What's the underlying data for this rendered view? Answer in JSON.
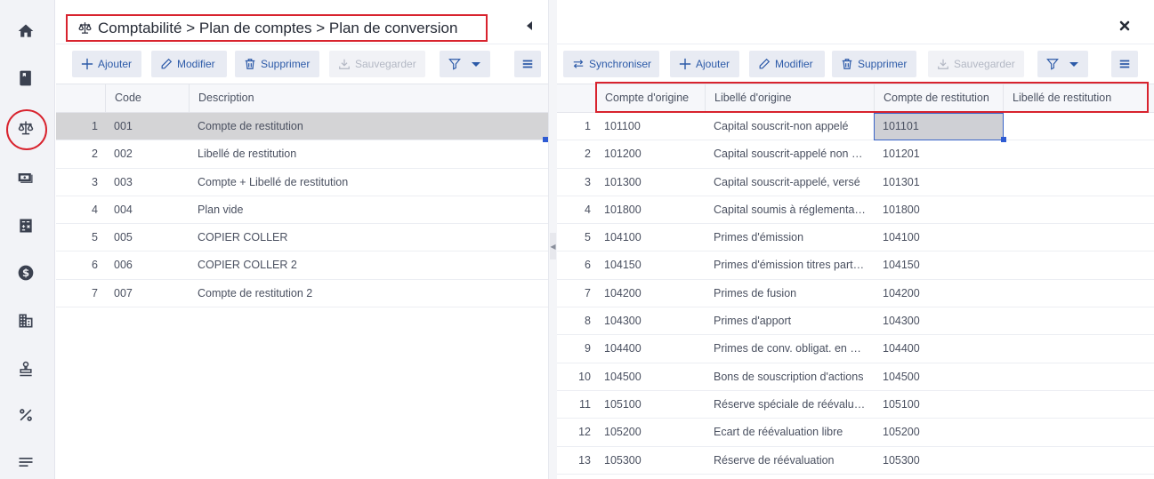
{
  "rail": {
    "items": [
      {
        "name": "home-icon",
        "label": "Accueil"
      },
      {
        "name": "book-icon",
        "label": "Livre"
      },
      {
        "name": "scale-icon",
        "label": "Comptabilité",
        "active": true
      },
      {
        "name": "money-icon",
        "label": "Finances"
      },
      {
        "name": "calculator-icon",
        "label": "Calculatrice"
      },
      {
        "name": "dollar-icon",
        "label": "Dollar"
      },
      {
        "name": "building-icon",
        "label": "Entreprise"
      },
      {
        "name": "stamp-icon",
        "label": "Tampon"
      },
      {
        "name": "percent-icon",
        "label": "Pourcentage"
      },
      {
        "name": "list-icon",
        "label": "Liste"
      }
    ],
    "highlight_color": "#d8232e"
  },
  "left_panel": {
    "breadcrumb": "Comptabilité > Plan de comptes > Plan de conversion",
    "toolbar": {
      "add": "Ajouter",
      "edit": "Modifier",
      "delete": "Supprimer",
      "save": "Sauvegarder"
    },
    "columns": [
      "Code",
      "Description"
    ],
    "rows": [
      {
        "n": "1",
        "code": "001",
        "description": "Compte de restitution",
        "selected": true
      },
      {
        "n": "2",
        "code": "002",
        "description": "Libellé de restitution"
      },
      {
        "n": "3",
        "code": "003",
        "description": "Compte + Libellé de restitution"
      },
      {
        "n": "4",
        "code": "004",
        "description": "Plan vide"
      },
      {
        "n": "5",
        "code": "005",
        "description": "COPIER COLLER"
      },
      {
        "n": "6",
        "code": "006",
        "description": "COPIER COLLER 2"
      },
      {
        "n": "7",
        "code": "007",
        "description": "Compte de restitution 2"
      }
    ]
  },
  "right_panel": {
    "toolbar": {
      "sync": "Synchroniser",
      "add": "Ajouter",
      "edit": "Modifier",
      "delete": "Supprimer",
      "save": "Sauvegarder"
    },
    "columns": [
      "Compte d'origine",
      "Libellé d'origine",
      "Compte de restitution",
      "Libellé de restitution"
    ],
    "rows": [
      {
        "n": "1",
        "origin": "101100",
        "label": "Capital souscrit-non appelé",
        "restit": "101101",
        "restit_label": ""
      },
      {
        "n": "2",
        "origin": "101200",
        "label": "Capital souscrit-appelé non versé",
        "restit": "101201",
        "restit_label": ""
      },
      {
        "n": "3",
        "origin": "101300",
        "label": "Capital souscrit-appelé, versé",
        "restit": "101301",
        "restit_label": ""
      },
      {
        "n": "4",
        "origin": "101800",
        "label": "Capital soumis à réglementation",
        "restit": "101800",
        "restit_label": ""
      },
      {
        "n": "5",
        "origin": "104100",
        "label": "Primes d'émission",
        "restit": "104100",
        "restit_label": ""
      },
      {
        "n": "6",
        "origin": "104150",
        "label": "Primes d'émission titres participatifs",
        "restit": "104150",
        "restit_label": ""
      },
      {
        "n": "7",
        "origin": "104200",
        "label": "Primes de fusion",
        "restit": "104200",
        "restit_label": ""
      },
      {
        "n": "8",
        "origin": "104300",
        "label": "Primes d'apport",
        "restit": "104300",
        "restit_label": ""
      },
      {
        "n": "9",
        "origin": "104400",
        "label": "Primes de conv. obligat. en actions",
        "restit": "104400",
        "restit_label": ""
      },
      {
        "n": "10",
        "origin": "104500",
        "label": "Bons de souscription d'actions",
        "restit": "104500",
        "restit_label": ""
      },
      {
        "n": "11",
        "origin": "105100",
        "label": "Réserve spéciale de réévaluation",
        "restit": "105100",
        "restit_label": ""
      },
      {
        "n": "12",
        "origin": "105200",
        "label": "Ecart de réévaluation libre",
        "restit": "105200",
        "restit_label": ""
      },
      {
        "n": "13",
        "origin": "105300",
        "label": "Réserve de réévaluation",
        "restit": "105300",
        "restit_label": ""
      }
    ]
  }
}
